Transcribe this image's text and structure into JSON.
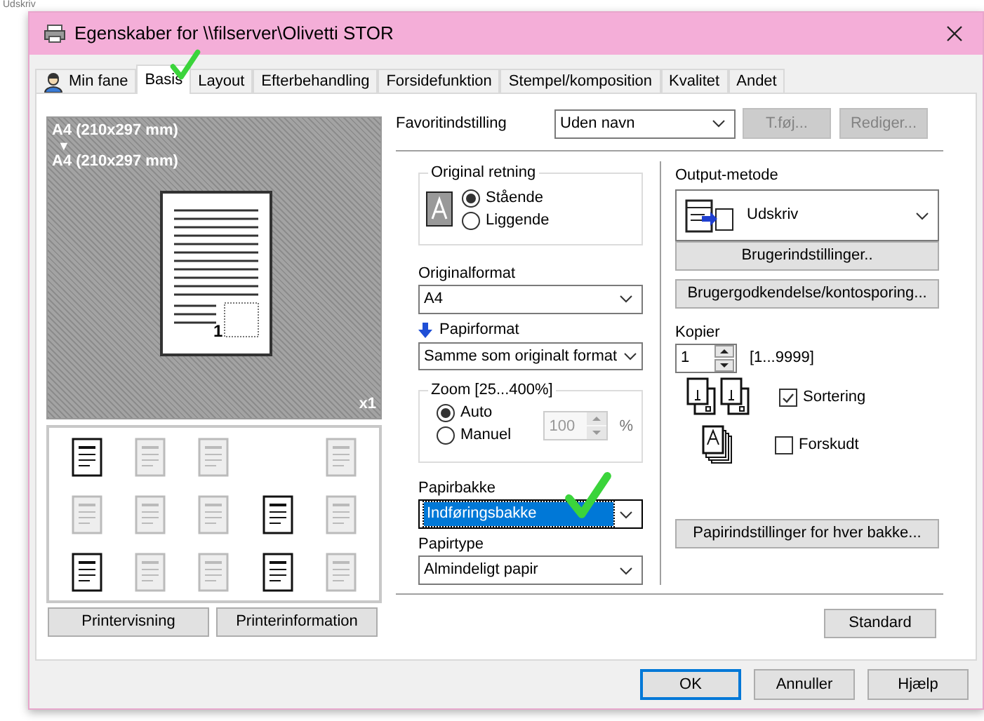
{
  "background": {
    "text": "Udskriv"
  },
  "window": {
    "title": "Egenskaber for \\\\filserver\\Olivetti STOR"
  },
  "tabs": [
    {
      "label": "Min fane",
      "kind": "with_icon",
      "selected": false
    },
    {
      "label": "Basis",
      "kind": "plain",
      "selected": true
    },
    {
      "label": "Layout",
      "kind": "plain",
      "selected": false
    },
    {
      "label": "Efterbehandling",
      "kind": "plain",
      "selected": false
    },
    {
      "label": "Forsidefunktion",
      "kind": "plain",
      "selected": false
    },
    {
      "label": "Stempel/komposition",
      "kind": "plain",
      "selected": false
    },
    {
      "label": "Kvalitet",
      "kind": "plain",
      "selected": false
    },
    {
      "label": "Andet",
      "kind": "plain",
      "selected": false
    }
  ],
  "preview": {
    "original_size": "A4 (210x297 mm)",
    "arrow": "▼",
    "paper_size": "A4 (210x297 mm)",
    "page_number": "1",
    "copies_badge": "x1"
  },
  "function_icons": [
    {
      "kind": "icon",
      "enabled": true
    },
    {
      "kind": "icon",
      "enabled": false
    },
    {
      "kind": "icon",
      "enabled": false
    },
    {
      "kind": "empty"
    },
    {
      "kind": "icon",
      "enabled": false
    },
    {
      "kind": "icon",
      "enabled": false
    },
    {
      "kind": "icon",
      "enabled": false
    },
    {
      "kind": "icon",
      "enabled": false
    },
    {
      "kind": "icon",
      "enabled": true
    },
    {
      "kind": "icon",
      "enabled": false
    },
    {
      "kind": "icon",
      "enabled": true
    },
    {
      "kind": "icon",
      "enabled": false
    },
    {
      "kind": "icon",
      "enabled": false
    },
    {
      "kind": "icon",
      "enabled": true
    },
    {
      "kind": "icon",
      "enabled": false
    }
  ],
  "preview_buttons": [
    "Printervisning",
    "Printerinformation"
  ],
  "favorite": {
    "label": "Favoritindstilling",
    "value": "Uden navn",
    "buttons": [
      {
        "label": "T.føj...",
        "disabled": true
      },
      {
        "label": "Rediger...",
        "disabled": true
      }
    ]
  },
  "orientation": {
    "title": "Original retning",
    "options": [
      {
        "label": "Stående",
        "selected": true
      },
      {
        "label": "Liggende",
        "selected": false
      }
    ]
  },
  "original_format": {
    "label": "Originalformat",
    "value": "A4"
  },
  "paper_format": {
    "label": "Papirformat",
    "value": "Samme som originalt format"
  },
  "zoom": {
    "title": "Zoom [25...400%]",
    "options": [
      {
        "label": "Auto",
        "selected": true
      },
      {
        "label": "Manuel",
        "selected": false
      }
    ],
    "value": "100",
    "disabled": true,
    "unit": "%"
  },
  "paper_tray": {
    "label": "Papirbakke",
    "value": "Indføringsbakke",
    "focused": true
  },
  "paper_type": {
    "label": "Papirtype",
    "value": "Almindeligt papir"
  },
  "output_method": {
    "label": "Output-metode",
    "value": "Udskriv"
  },
  "user_buttons": [
    "Brugerindstillinger..",
    "Brugergodkendelse/kontosporing..."
  ],
  "copies": {
    "label": "Kopier",
    "value": "1",
    "range": "[1...9999]"
  },
  "collate": {
    "label": "Sortering",
    "checked": true
  },
  "offset": {
    "label": "Forskudt",
    "checked": false
  },
  "tray_settings_button": "Papirindstillinger for hver bakke...",
  "standard_button": "Standard",
  "footer_buttons": [
    {
      "label": "OK",
      "default": true
    },
    {
      "label": "Annuller",
      "default": false
    },
    {
      "label": "Hjælp",
      "default": false
    }
  ]
}
